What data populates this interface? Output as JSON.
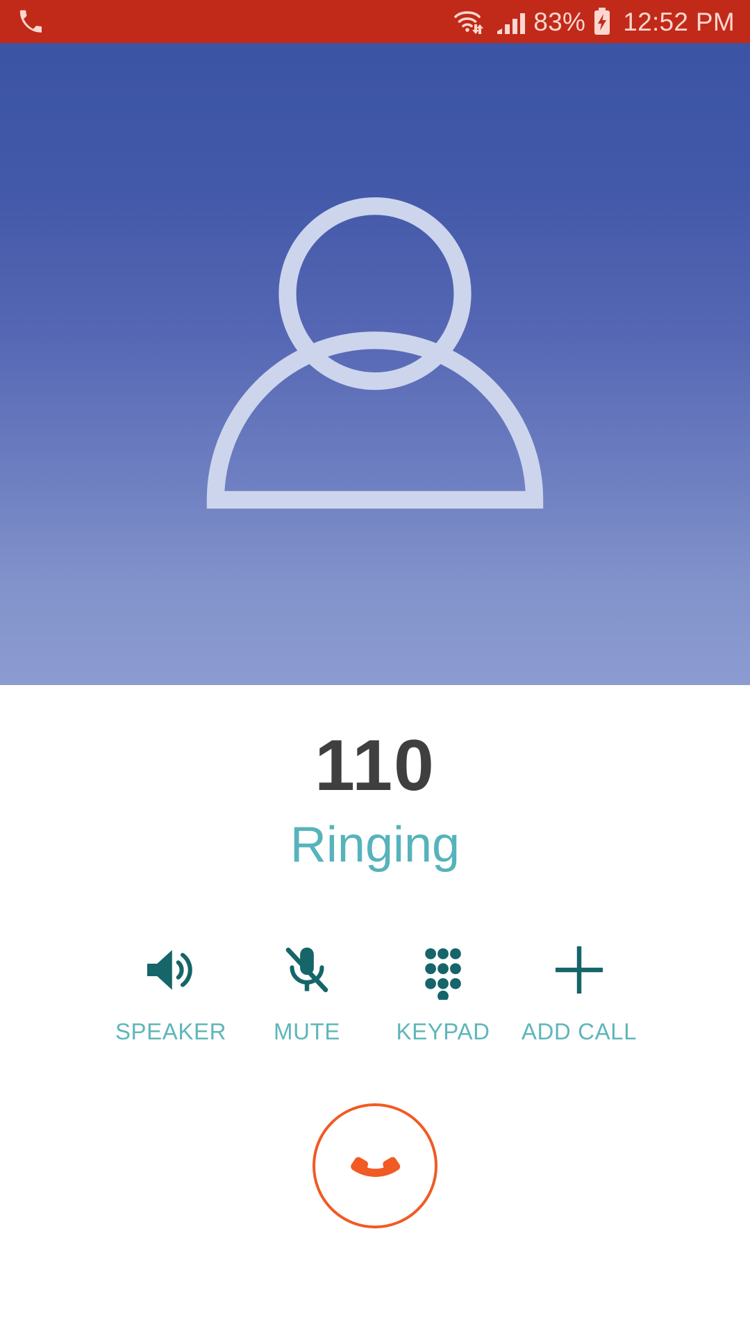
{
  "status_bar": {
    "background_color": "#c12a19",
    "foreground_color": "#fbd7d0",
    "call_icon": "phone-call-icon",
    "wifi_icon": "wifi-with-data-transfer-icon",
    "signal_icon": "cellular-signal-icon",
    "battery_percent": "83%",
    "battery_icon": "battery-charging-icon",
    "time": "12:52 PM"
  },
  "photo": {
    "avatar_icon": "default-contact-avatar-icon",
    "gradient_top_color": "#3c54a4",
    "gradient_bottom_color": "#8c9cd2",
    "avatar_color": "#ccd4ec"
  },
  "call": {
    "number": "110",
    "state": "Ringing",
    "number_color": "#3f3f3f",
    "state_color": "#56b3bb"
  },
  "actions": {
    "accent_color": "#156569",
    "label_color": "#5fb6ba",
    "items": [
      {
        "label": "SPEAKER",
        "icon": "speaker-volume-icon"
      },
      {
        "label": "MUTE",
        "icon": "microphone-muted-icon"
      },
      {
        "label": "KEYPAD",
        "icon": "dialpad-icon"
      },
      {
        "label": "ADD CALL",
        "icon": "plus-icon"
      }
    ]
  },
  "end_call": {
    "icon": "end-call-handset-icon",
    "color": "#f15a24"
  }
}
